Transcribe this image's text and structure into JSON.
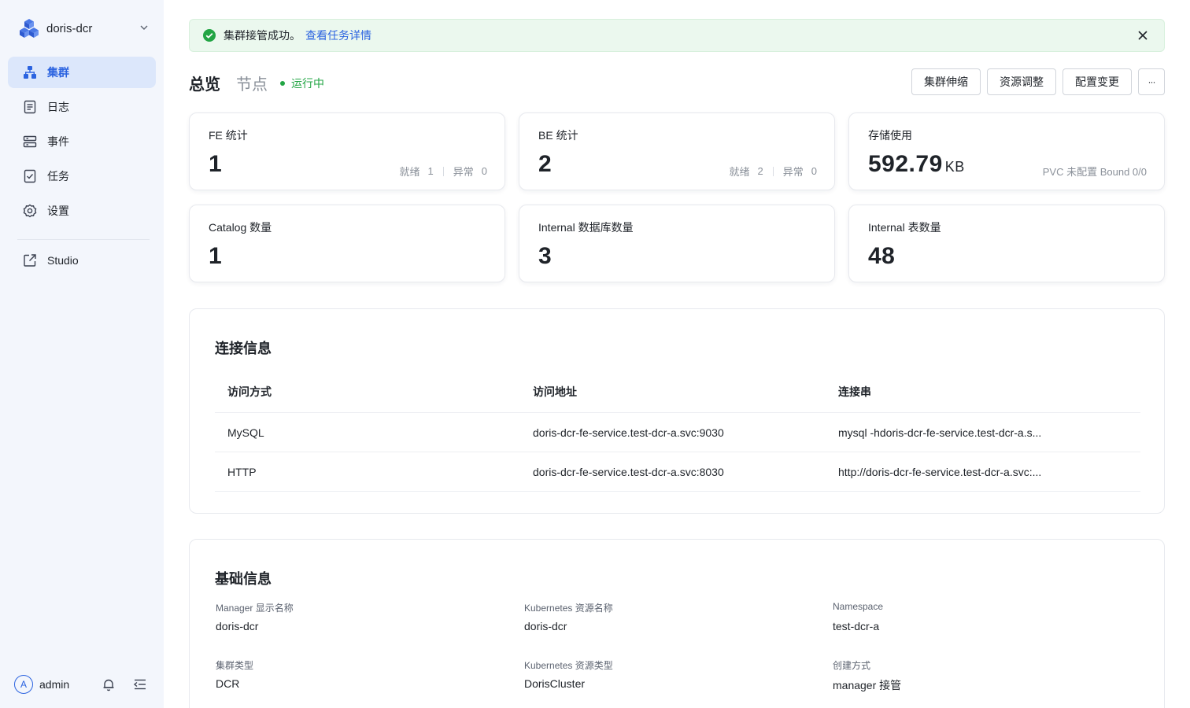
{
  "sidebar": {
    "cluster_name": "doris-dcr",
    "items": [
      {
        "label": "集群",
        "icon": "cluster-icon",
        "active": true
      },
      {
        "label": "日志",
        "icon": "log-icon",
        "active": false
      },
      {
        "label": "事件",
        "icon": "event-icon",
        "active": false
      },
      {
        "label": "任务",
        "icon": "task-icon",
        "active": false
      },
      {
        "label": "设置",
        "icon": "gear-icon",
        "active": false
      }
    ],
    "studio_label": "Studio",
    "user_initial": "A",
    "user_name": "admin"
  },
  "alert": {
    "message": "集群接管成功。",
    "link_text": "查看任务详情"
  },
  "tabs": {
    "overview": "总览",
    "nodes": "节点",
    "status": "运行中"
  },
  "actions": {
    "scale": "集群伸缩",
    "resource": "资源调整",
    "config": "配置变更",
    "more": "···"
  },
  "stats": {
    "fe": {
      "label": "FE 统计",
      "value": "1",
      "ready_label": "就绪",
      "ready": "1",
      "abnormal_label": "异常",
      "abnormal": "0"
    },
    "be": {
      "label": "BE 统计",
      "value": "2",
      "ready_label": "就绪",
      "ready": "2",
      "abnormal_label": "异常",
      "abnormal": "0"
    },
    "storage": {
      "label": "存储使用",
      "value": "592.79",
      "unit": "KB",
      "note": "PVC 未配置 Bound 0/0"
    },
    "catalog": {
      "label": "Catalog 数量",
      "value": "1"
    },
    "databases": {
      "label": "Internal 数据库数量",
      "value": "3"
    },
    "tables": {
      "label": "Internal 表数量",
      "value": "48"
    }
  },
  "connection": {
    "title": "连接信息",
    "headers": [
      "访问方式",
      "访问地址",
      "连接串"
    ],
    "rows": [
      [
        "MySQL",
        "doris-dcr-fe-service.test-dcr-a.svc:9030",
        "mysql -hdoris-dcr-fe-service.test-dcr-a.s..."
      ],
      [
        "HTTP",
        "doris-dcr-fe-service.test-dcr-a.svc:8030",
        "http://doris-dcr-fe-service.test-dcr-a.svc:..."
      ]
    ]
  },
  "basic": {
    "title": "基础信息",
    "fields": [
      {
        "label": "Manager 显示名称",
        "value": "doris-dcr"
      },
      {
        "label": "Kubernetes 资源名称",
        "value": "doris-dcr"
      },
      {
        "label": "Namespace",
        "value": "test-dcr-a"
      },
      {
        "label": "集群类型",
        "value": "DCR"
      },
      {
        "label": "Kubernetes 资源类型",
        "value": "DorisCluster"
      },
      {
        "label": "创建方式",
        "value": "manager 接管"
      }
    ]
  },
  "colors": {
    "accent": "#2b63e0",
    "success": "#22a544",
    "sidebar_bg": "#f3f6fc",
    "alert_bg": "#ebf8ee"
  }
}
